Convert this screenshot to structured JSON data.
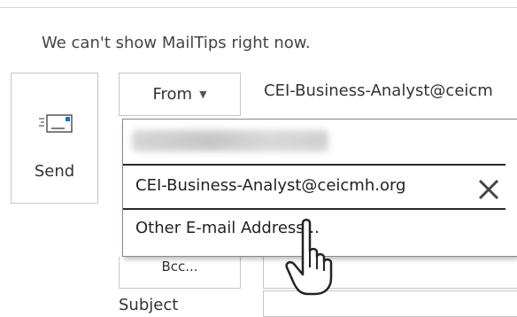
{
  "notice": {
    "mailtips": "We can't show MailTips right now."
  },
  "send": {
    "label": "Send",
    "icon": "send-envelope-icon"
  },
  "from": {
    "label": "From",
    "address": "CEI-Business-Analyst@ceicm"
  },
  "dropdown": {
    "items": [
      {
        "label": ""
      },
      {
        "label": "CEI-Business-Analyst@ceicmh.org"
      },
      {
        "label": "Other E-mail Address..."
      }
    ]
  },
  "fields": {
    "bcc_label": "Bcc...",
    "subject_label": "Subject"
  }
}
